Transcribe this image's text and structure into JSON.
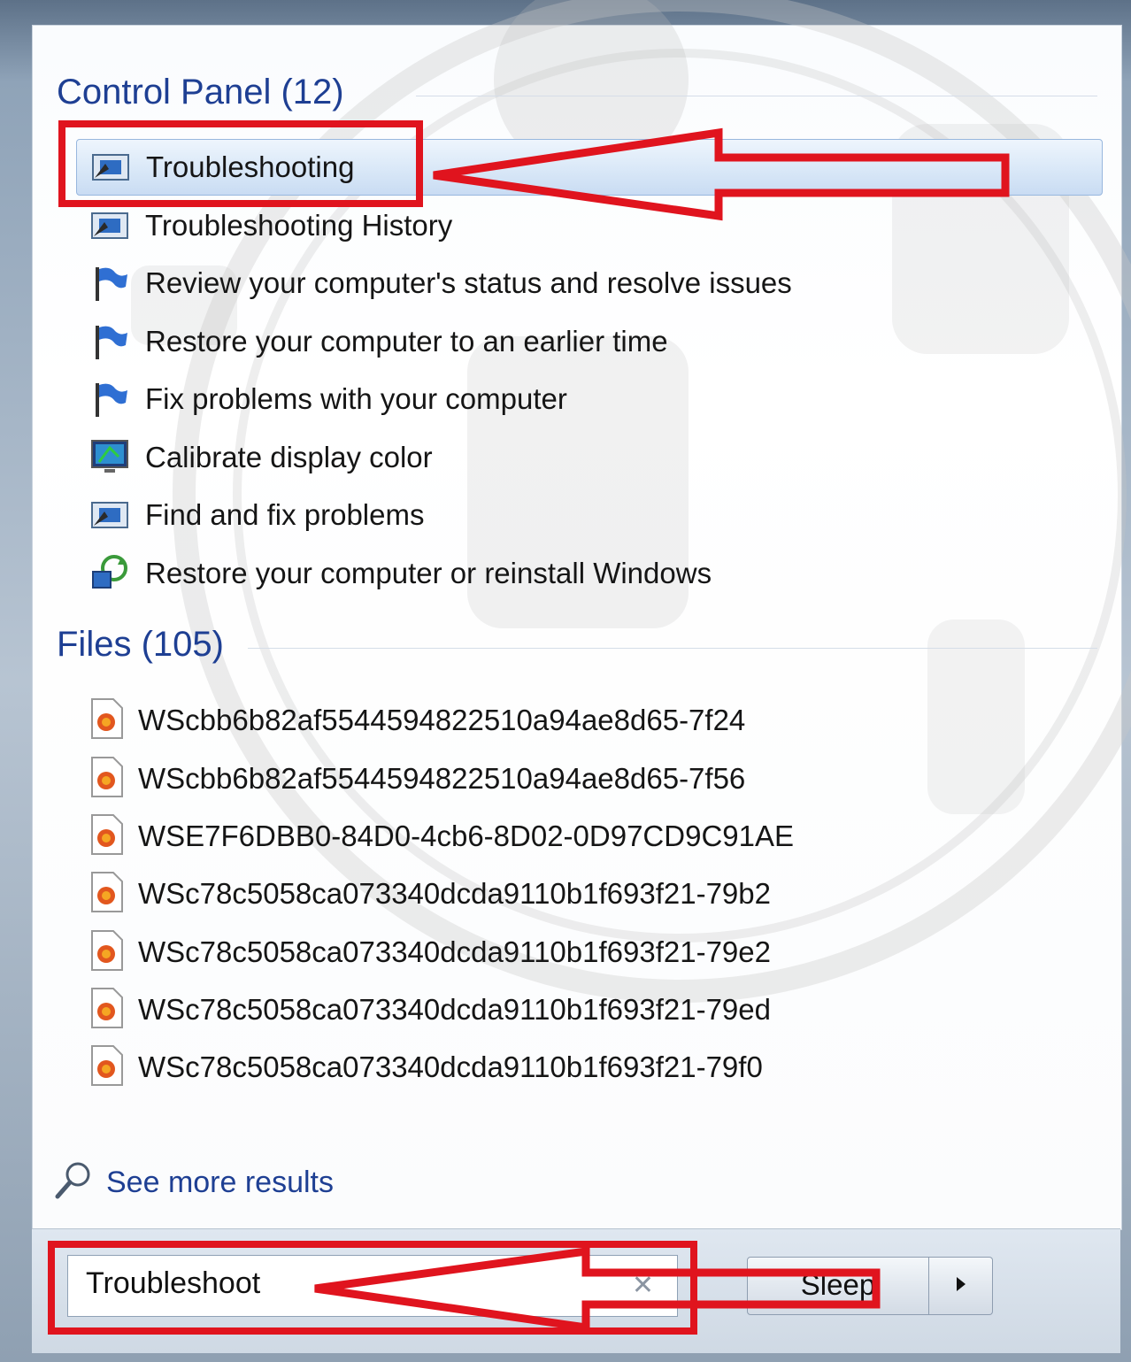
{
  "control_panel": {
    "title": "Control Panel (12)",
    "items": [
      {
        "label": "Troubleshooting",
        "icon": "troubleshooting-icon",
        "selected": true
      },
      {
        "label": "Troubleshooting History",
        "icon": "troubleshooting-icon"
      },
      {
        "label": "Review your computer's status and resolve issues",
        "icon": "flag-icon"
      },
      {
        "label": "Restore your computer to an earlier time",
        "icon": "flag-icon"
      },
      {
        "label": "Fix problems with your computer",
        "icon": "flag-icon"
      },
      {
        "label": "Calibrate display color",
        "icon": "monitor-icon"
      },
      {
        "label": "Find and fix problems",
        "icon": "troubleshooting-icon"
      },
      {
        "label": "Restore your computer or reinstall Windows",
        "icon": "recovery-icon"
      }
    ]
  },
  "files": {
    "title": "Files (105)",
    "items": [
      {
        "label": "WScbb6b82af5544594822510a94ae8d65-7f24",
        "icon": "firefox-file-icon"
      },
      {
        "label": "WScbb6b82af5544594822510a94ae8d65-7f56",
        "icon": "firefox-file-icon"
      },
      {
        "label": "WSE7F6DBB0-84D0-4cb6-8D02-0D97CD9C91AE",
        "icon": "firefox-file-icon"
      },
      {
        "label": "WSc78c5058ca073340dcda9110b1f693f21-79b2",
        "icon": "firefox-file-icon"
      },
      {
        "label": "WSc78c5058ca073340dcda9110b1f693f21-79e2",
        "icon": "firefox-file-icon"
      },
      {
        "label": "WSc78c5058ca073340dcda9110b1f693f21-79ed",
        "icon": "firefox-file-icon"
      },
      {
        "label": "WSc78c5058ca073340dcda9110b1f693f21-79f0",
        "icon": "firefox-file-icon"
      }
    ]
  },
  "see_more": {
    "label": "See more results",
    "icon": "search-icon"
  },
  "search": {
    "value": "Troubleshoot",
    "clear_icon": "close-icon"
  },
  "power": {
    "label": "Sleep",
    "arrow_icon": "chevron-right-icon"
  },
  "colors": {
    "accent": "#1e3f93",
    "annotation": "#e0141e",
    "selection": "#dbe9f8"
  }
}
